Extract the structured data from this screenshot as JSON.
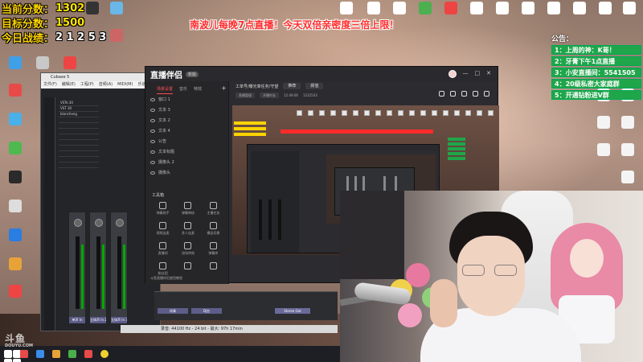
{
  "overlay": {
    "stats": [
      {
        "label": "当前分数：",
        "value": "1302"
      },
      {
        "label": "目标分数：",
        "value": "1500"
      },
      {
        "label": "今日战绩：",
        "value": "2 1 2 5 3"
      }
    ],
    "banner": "南波儿每晚7点直播！今天双倍亲密度三倍上限！",
    "announcement": {
      "title": "公告：",
      "items": [
        "1：上周的神：K哥！",
        "2：牙膏下午1点直播",
        "3：小安直播间：5541505",
        "4：20级私密大家庭群",
        "5：开通钻粉进V群"
      ]
    }
  },
  "cubase": {
    "title": "Cubase 5",
    "menu": [
      "文件(F)",
      "编辑(E)",
      "工程(P)",
      "音频(A)",
      "MIDI(M)",
      "乐谱(S)"
    ],
    "tracks": [
      "VSTe.30",
      "VST 30",
      "blanchang",
      "",
      "",
      "",
      "",
      "",
      "",
      "",
      "",
      "",
      "",
      "",
      "",
      ""
    ],
    "strips": [
      "单声 In",
      "立体声 In 2",
      "立体声 In 3"
    ],
    "mixer_labels": [
      "单声 In",
      "立体声 In 2",
      "立体声 In 3",
      "伴奏",
      "DJ台",
      "Stereo Out"
    ],
    "status": "录音: 44100 Hz - 24 bit - 最大: 97h 17min"
  },
  "live_app": {
    "logo": "直播伴侣",
    "version": "新版",
    "left_tabs": [
      "场景设置",
      "音乐",
      "特效"
    ],
    "scenes": [
      "窗口 1",
      "文本 3",
      "文本 2",
      "文本 4",
      "公告",
      "文本标题",
      "摄像头 2",
      "摄像头"
    ],
    "tools_title": "工具箱",
    "tools": [
      "弹幕助手",
      "弹幕审核",
      "主播任务",
      "视频连麦",
      "多人连麦",
      "横竖切换",
      "直播间",
      "进场特效",
      "弹幕库",
      "粉丝团",
      "",
      ""
    ],
    "tools_footer": "斗鱼直播伴侣使用教程",
    "info_title": "工单号/曝光率任务/守望",
    "info_chip1": "推荐",
    "info_chip2": "颜值",
    "info2": [
      "直播管理",
      "开播时长",
      "12:49:06",
      "1232543"
    ],
    "bottom_buttons": [
      "直播屏幕",
      "摄像头",
      "手机投屏"
    ],
    "window_buttons": [
      "—",
      "□",
      "✕"
    ]
  },
  "watermark": {
    "brand": "斗鱼",
    "sub": "DOUYU.COM"
  },
  "colors": {
    "stat_yellow": "#ffd400",
    "banner_red": "#ff2b2b",
    "announce_green": "#1fa64a",
    "accent_red": "#ff4d4f"
  }
}
